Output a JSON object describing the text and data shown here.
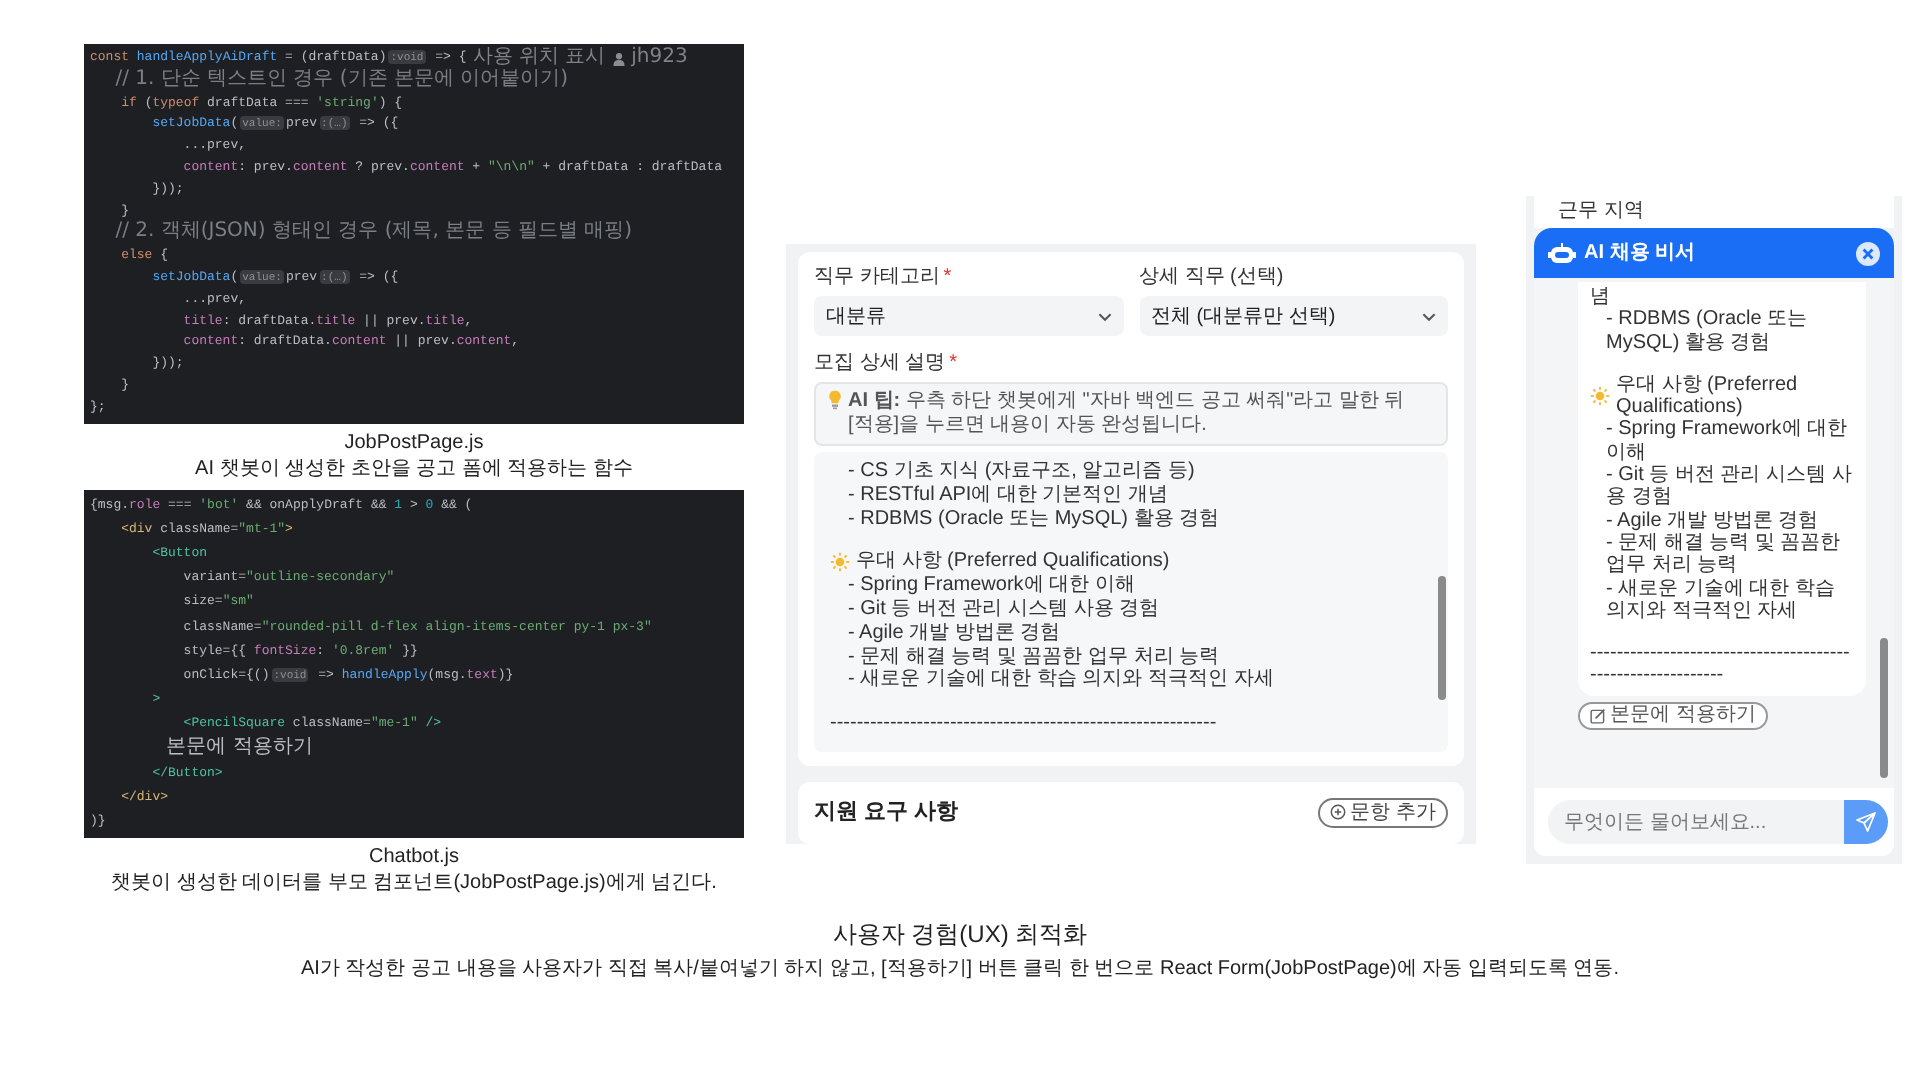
{
  "code_panels": [
    {
      "filename": "JobPostPage.js",
      "caption": "AI 챗봇이 생성한 초안을 공고 폼에 적용하는 함수",
      "lines": [
        {
          "tokens": [
            {
              "kind": "keyword",
              "text": "const "
            },
            {
              "kind": "function",
              "text": "handleApplyAiDraft"
            },
            {
              "kind": "plain",
              "text": " = (draftData)"
            },
            {
              "kind": "hint",
              "text": ":void"
            },
            {
              "kind": "plain",
              "text": " => {"
            }
          ],
          "inlays": [
            {
              "kind": "usage",
              "text": "사용 위치 표시"
            },
            {
              "kind": "author",
              "text": "jh923"
            }
          ]
        },
        {
          "tokens": [
            {
              "kind": "comment",
              "text": "    // 1. 단순 텍스트인 경우 (기존 본문에 이어붙이기)"
            }
          ]
        },
        {
          "tokens": [
            {
              "kind": "keyword",
              "text": "    if "
            },
            {
              "kind": "plain",
              "text": "("
            },
            {
              "kind": "keyword",
              "text": "typeof "
            },
            {
              "kind": "plain",
              "text": "draftData === "
            },
            {
              "kind": "string",
              "text": "'string'"
            },
            {
              "kind": "plain",
              "text": ") {"
            }
          ]
        },
        {
          "tokens": [
            {
              "kind": "function",
              "text": "        setJobData"
            },
            {
              "kind": "plain",
              "text": "("
            },
            {
              "kind": "hint",
              "text": "value:"
            },
            {
              "kind": "plain",
              "text": "prev"
            },
            {
              "kind": "hint",
              "text": ":(…)"
            },
            {
              "kind": "plain",
              "text": " => ({"
            }
          ]
        },
        {
          "tokens": [
            {
              "kind": "plain",
              "text": "            ...prev,"
            }
          ]
        },
        {
          "tokens": [
            {
              "kind": "property",
              "text": "            content"
            },
            {
              "kind": "plain",
              "text": ": prev."
            },
            {
              "kind": "property",
              "text": "content"
            },
            {
              "kind": "plain",
              "text": " ? prev."
            },
            {
              "kind": "property",
              "text": "content"
            },
            {
              "kind": "plain",
              "text": " + "
            },
            {
              "kind": "string",
              "text": "\"\\n\\n\""
            },
            {
              "kind": "plain",
              "text": " + draftData : draftData"
            }
          ]
        },
        {
          "tokens": [
            {
              "kind": "plain",
              "text": "        }));"
            }
          ]
        },
        {
          "tokens": [
            {
              "kind": "plain",
              "text": "    }"
            }
          ]
        },
        {
          "tokens": [
            {
              "kind": "comment",
              "text": "    // 2. 객체(JSON) 형태인 경우 (제목, 본문 등 필드별 매핑)"
            }
          ]
        },
        {
          "tokens": [
            {
              "kind": "keyword",
              "text": "    else "
            },
            {
              "kind": "plain",
              "text": "{"
            }
          ]
        },
        {
          "tokens": [
            {
              "kind": "function",
              "text": "        setJobData"
            },
            {
              "kind": "plain",
              "text": "("
            },
            {
              "kind": "hint",
              "text": "value:"
            },
            {
              "kind": "plain",
              "text": "prev"
            },
            {
              "kind": "hint",
              "text": ":(…)"
            },
            {
              "kind": "plain",
              "text": " => ({"
            }
          ]
        },
        {
          "tokens": [
            {
              "kind": "plain",
              "text": "            ...prev,"
            }
          ]
        },
        {
          "tokens": [
            {
              "kind": "property",
              "text": "            title"
            },
            {
              "kind": "plain",
              "text": ": draftData."
            },
            {
              "kind": "property",
              "text": "title"
            },
            {
              "kind": "plain",
              "text": " || prev."
            },
            {
              "kind": "property",
              "text": "title"
            },
            {
              "kind": "plain",
              "text": ","
            }
          ]
        },
        {
          "tokens": [
            {
              "kind": "property",
              "text": "            content"
            },
            {
              "kind": "plain",
              "text": ": draftData."
            },
            {
              "kind": "property",
              "text": "content"
            },
            {
              "kind": "plain",
              "text": " || prev."
            },
            {
              "kind": "property",
              "text": "content"
            },
            {
              "kind": "plain",
              "text": ","
            }
          ]
        },
        {
          "tokens": [
            {
              "kind": "plain",
              "text": "        }));"
            }
          ]
        },
        {
          "tokens": [
            {
              "kind": "plain",
              "text": "    }"
            }
          ]
        },
        {
          "tokens": [
            {
              "kind": "plain",
              "text": "};"
            }
          ]
        }
      ]
    },
    {
      "filename": "Chatbot.js",
      "caption": "챗봇이 생성한 데이터를 부모 컴포넌트(JobPostPage.js)에게 넘긴다.",
      "lines": [
        {
          "tokens": [
            {
              "kind": "plain",
              "text": "{msg."
            },
            {
              "kind": "property",
              "text": "role"
            },
            {
              "kind": "plain",
              "text": " === "
            },
            {
              "kind": "string",
              "text": "'bot'"
            },
            {
              "kind": "plain",
              "text": " && onApplyDraft && "
            },
            {
              "kind": "number",
              "text": "1"
            },
            {
              "kind": "plain",
              "text": " > "
            },
            {
              "kind": "number",
              "text": "0"
            },
            {
              "kind": "plain",
              "text": " && ("
            }
          ]
        },
        {
          "tokens": [
            {
              "kind": "tag",
              "text": "    <div"
            },
            {
              "kind": "plain",
              "text": " className="
            },
            {
              "kind": "string",
              "text": "\"mt-1\""
            },
            {
              "kind": "tag",
              "text": ">"
            }
          ]
        },
        {
          "tokens": [
            {
              "kind": "component",
              "text": "        <Button"
            }
          ]
        },
        {
          "tokens": [
            {
              "kind": "plain",
              "text": "            variant="
            },
            {
              "kind": "string",
              "text": "\"outline-secondary\""
            }
          ]
        },
        {
          "tokens": [
            {
              "kind": "plain",
              "text": "            size="
            },
            {
              "kind": "string",
              "text": "\"sm\""
            }
          ]
        },
        {
          "tokens": [
            {
              "kind": "plain",
              "text": "            className="
            },
            {
              "kind": "string",
              "text": "\"rounded-pill d-flex align-items-center py-1 px-3\""
            }
          ]
        },
        {
          "tokens": [
            {
              "kind": "plain",
              "text": "            style={{ "
            },
            {
              "kind": "property",
              "text": "fontSize"
            },
            {
              "kind": "plain",
              "text": ": "
            },
            {
              "kind": "string",
              "text": "'0.8rem'"
            },
            {
              "kind": "plain",
              "text": " }}"
            }
          ]
        },
        {
          "tokens": [
            {
              "kind": "plain",
              "text": "            onClick={()"
            },
            {
              "kind": "hint",
              "text": ":void"
            },
            {
              "kind": "plain",
              "text": " => "
            },
            {
              "kind": "function",
              "text": "handleApply"
            },
            {
              "kind": "plain",
              "text": "(msg."
            },
            {
              "kind": "property",
              "text": "text"
            },
            {
              "kind": "plain",
              "text": ")}"
            }
          ]
        },
        {
          "tokens": [
            {
              "kind": "component",
              "text": "        >"
            }
          ]
        },
        {
          "tokens": [
            {
              "kind": "component",
              "text": "            <PencilSquare"
            },
            {
              "kind": "plain",
              "text": " className="
            },
            {
              "kind": "string",
              "text": "\"me-1\""
            },
            {
              "kind": "component",
              "text": " />"
            }
          ]
        },
        {
          "tokens": [
            {
              "kind": "text",
              "text": "            본문에 적용하기"
            }
          ]
        },
        {
          "tokens": [
            {
              "kind": "component",
              "text": "        </Button>"
            }
          ]
        },
        {
          "tokens": [
            {
              "kind": "tag",
              "text": "    </div>"
            }
          ]
        },
        {
          "tokens": [
            {
              "kind": "plain",
              "text": ")}"
            }
          ]
        }
      ]
    }
  ],
  "form": {
    "fields": [
      {
        "label": "직무 카테고리",
        "required_mark": "*",
        "value": "대분류"
      },
      {
        "label": "상세 직무 (선택)",
        "value": "전체 (대분류만 선택)"
      }
    ],
    "description": {
      "label": "모집 상세 설명",
      "required_mark": "*",
      "tip": "**AI 팁:** 우측 하단 챗봇에게 \"자바 백엔드 공고 써줘\"라고 말한 뒤 [적용]을 누르면 내용이 자동 완성됩니다.",
      "lines": [
        {
          "kind": "item",
          "text": "- CS 기초 지식 (자료구조, 알고리즘 등)"
        },
        {
          "kind": "item",
          "text": "- RESTful API에 대한 기본적인 개념"
        },
        {
          "kind": "item",
          "text": "- RDBMS (Oracle 또는 MySQL) 활용 경험"
        },
        {
          "kind": "gap"
        },
        {
          "kind": "heading",
          "text": "우대 사항 (Preferred Qualifications)"
        },
        {
          "kind": "item",
          "text": "- Spring Framework에 대한 이해"
        },
        {
          "kind": "item",
          "text": "- Git 등 버전 관리 시스템 사용 경험"
        },
        {
          "kind": "item",
          "text": "- Agile 개발 방법론 경험"
        },
        {
          "kind": "item",
          "text": "- 문제 해결 능력 및 꼼꼼한 업무 처리 능력"
        },
        {
          "kind": "item",
          "text": "- 새로운 기술에 대한 학습 의지와 적극적인 자세"
        },
        {
          "kind": "gap"
        },
        {
          "kind": "divider",
          "text": "----------------------------------------------------------"
        }
      ]
    },
    "requirements": {
      "title": "지원 요구 사항",
      "add_button": "문항 추가"
    }
  },
  "chatbot": {
    "context_label": "근무 지역",
    "title": "AI 채용 비서",
    "message_lines": [
      {
        "kind": "plain",
        "text": "념"
      },
      {
        "kind": "item",
        "text": "- RDBMS (Oracle 또는 MySQL) 활용 경험"
      },
      {
        "kind": "gap"
      },
      {
        "kind": "heading",
        "text": "우대 사항 (Preferred Qualifications)"
      },
      {
        "kind": "item",
        "text": "- Spring Framework에 대한 이해"
      },
      {
        "kind": "item",
        "text": "- Git 등 버전 관리 시스템 사용 경험"
      },
      {
        "kind": "item",
        "text": "- Agile 개발 방법론 경험"
      },
      {
        "kind": "item",
        "text": "- 문제 해결 능력 및 꼼꼼한 업무 처리 능력"
      },
      {
        "kind": "item",
        "text": "- 새로운 기술에 대한 학습 의지와 적극적인 자세"
      },
      {
        "kind": "gap"
      },
      {
        "kind": "divider",
        "text": "-----------------------------------------------------------"
      }
    ],
    "apply_button": "본문에 적용하기",
    "input_placeholder": "무엇이든 물어보세요..."
  },
  "summary": {
    "title": "사용자 경험(UX) 최적화",
    "text": "AI가 작성한 공고 내용을 사용자가 직접 복사/붙여넣기 하지 않고, [적용하기] 버튼 클릭 한 번으로 React Form(JobPostPage)에 자동 입력되도록 연동."
  }
}
